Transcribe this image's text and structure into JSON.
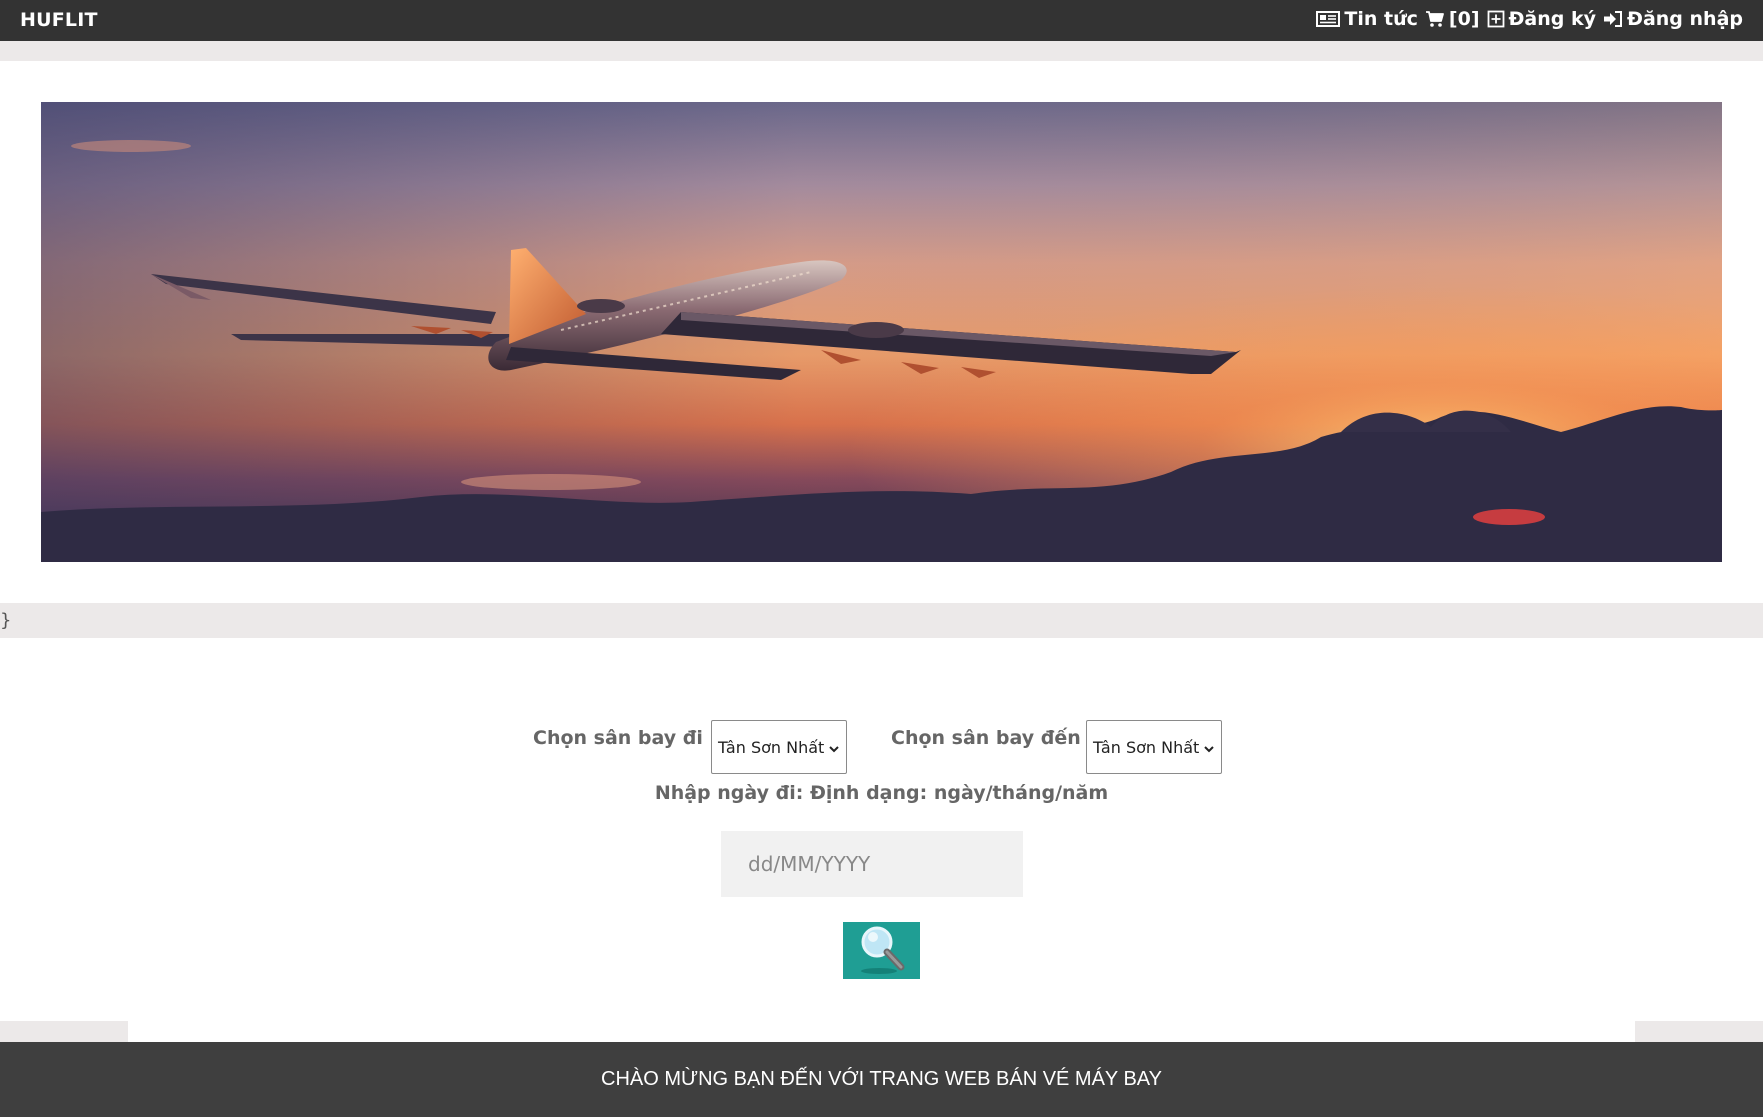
{
  "navbar": {
    "brand": "HUFLIT",
    "items": [
      {
        "icon": "newspaper-icon",
        "label": "Tin tức"
      },
      {
        "icon": "cart-icon",
        "label": "[0]"
      },
      {
        "icon": "plus-square-icon",
        "label": "Đăng ký"
      },
      {
        "icon": "login-icon",
        "label": "Đăng nhập"
      }
    ]
  },
  "banner": {
    "alt": "airplane-sunset-banner"
  },
  "stray_text": "}",
  "search": {
    "from_label": "Chọn sân bay đi",
    "from_value": "Tân Sơn Nhất",
    "to_label": "Chọn sân bay đến",
    "to_value": "Tân Sơn Nhất",
    "date_hint": "Nhập ngày đi: Định dạng: ngày/tháng/năm",
    "date_placeholder": "dd/MM/YYYY",
    "button_icon": "magnifier-icon"
  },
  "footer": {
    "text": "CHÀO MỪNG BẠN ĐẾN VỚI TRANG WEB BÁN VÉ MÁY BAY"
  },
  "colors": {
    "navbar_bg": "#333333",
    "band_gray": "#ece9e9",
    "button_teal": "#1f9e94",
    "footer_bg": "#3f3f3f"
  }
}
